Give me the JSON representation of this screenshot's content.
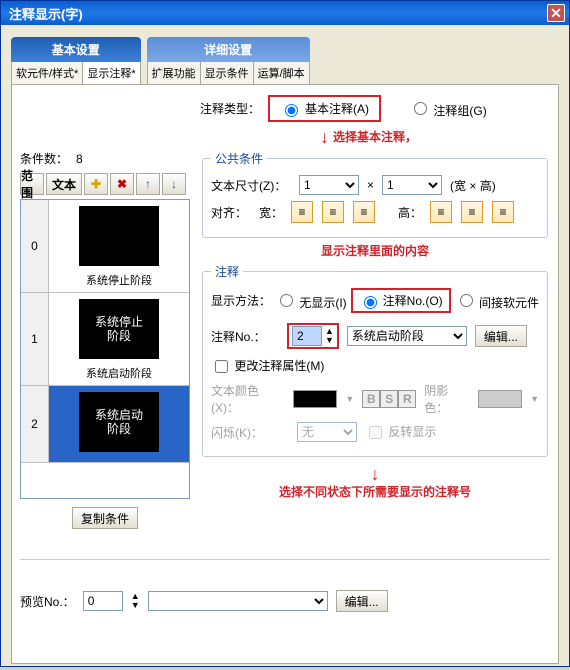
{
  "title": "注释显示(字)",
  "main_tabs": {
    "left": "基本设置",
    "right": "详细设置"
  },
  "sub_tabs": {
    "left": [
      "软元件/样式*",
      "显示注释*"
    ],
    "right": [
      "扩展功能",
      "显示条件",
      "运算/脚本"
    ]
  },
  "type_label": "注释类型：",
  "radio_basic": "基本注释(A)",
  "radio_group": "注释组(G)",
  "note_select_basic": "选择基本注释，",
  "count_label": "条件数：",
  "count_value": "8",
  "tool_range": "范围",
  "tool_text": "文本",
  "common": {
    "legend": "公共条件",
    "size_label": "文本尺寸(Z)：",
    "size_w": "1",
    "size_h": "1",
    "wh": "(宽 × 高)",
    "align_label": "对齐：",
    "align_w": "宽：",
    "align_h": "高："
  },
  "note_content": "显示注释里面的内容",
  "anno": {
    "legend": "注释",
    "method": "显示方法：",
    "r_none": "无显示(I)",
    "r_no": "注释No.(O)",
    "r_indirect": "间接软元件",
    "no_label": "注释No.：",
    "no_value": "2",
    "combo": "系统启动阶段",
    "edit": "编辑...",
    "chk_change": "更改注释属性(M)",
    "text_color": "文本颜色(X)：",
    "shadow_color": "阴影色：",
    "blink": "闪烁(K)：",
    "blink_none": "无",
    "invert": "反转显示"
  },
  "note_diff_state": "选择不同状态下所需要显示的注释号",
  "items": [
    {
      "idx": "0",
      "thumb": "",
      "label": "系统停止阶段",
      "selected": false
    },
    {
      "idx": "1",
      "thumb": "系统停止\n阶段",
      "label": "系统启动阶段",
      "selected": false
    },
    {
      "idx": "2",
      "thumb": "系统启动\n阶段",
      "label": "",
      "selected": true
    }
  ],
  "copy_cond": "复制条件",
  "preview_label": "预览No.：",
  "preview_value": "0",
  "preview_edit": "编辑..."
}
